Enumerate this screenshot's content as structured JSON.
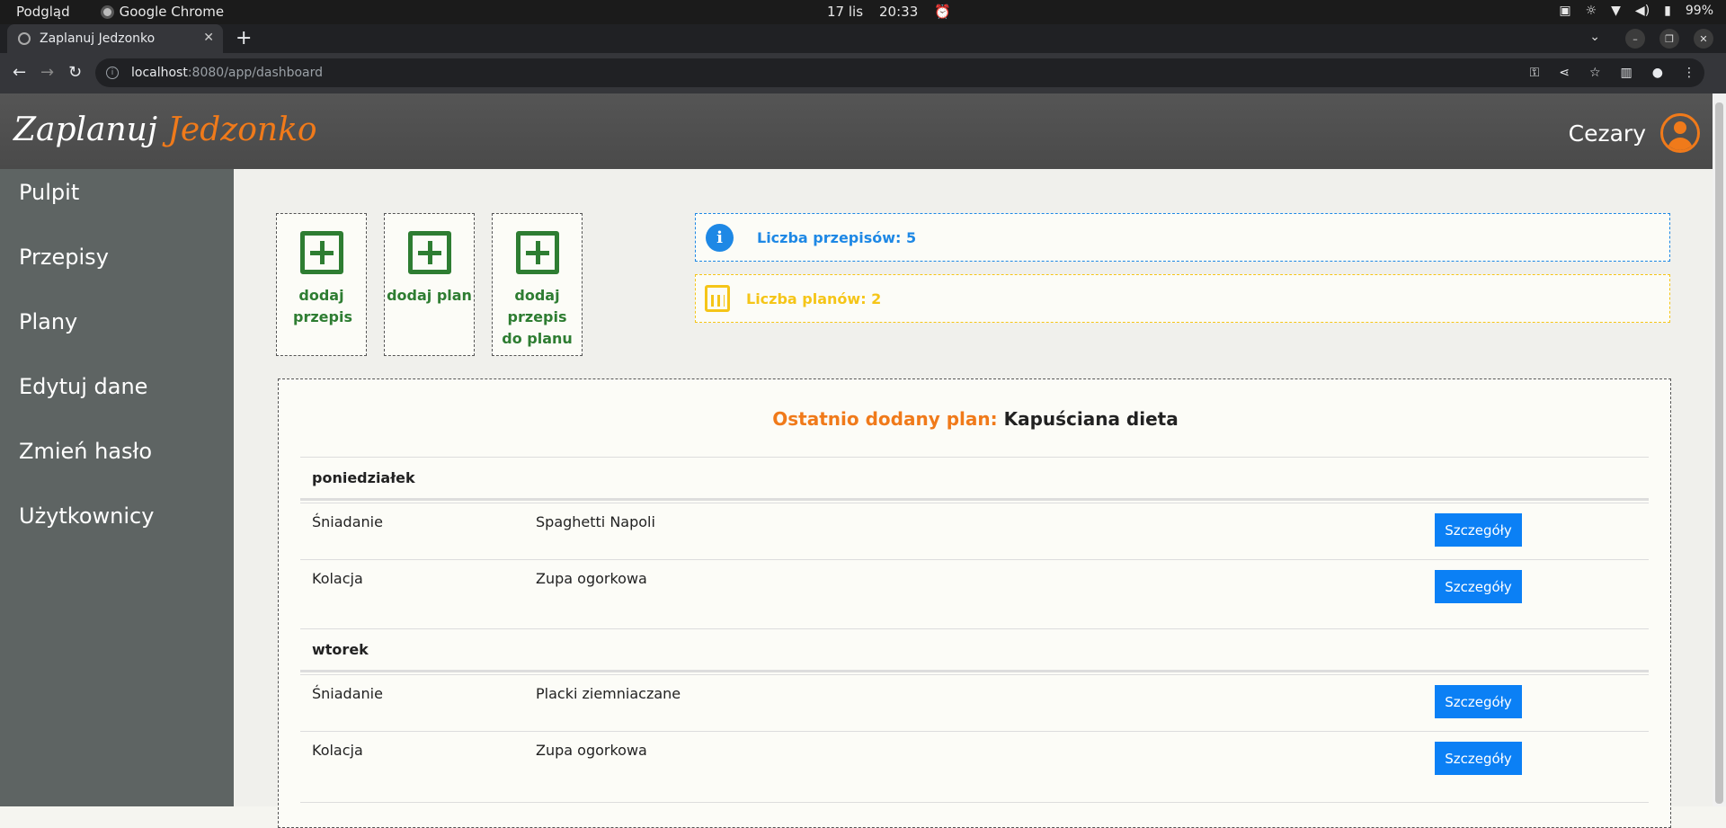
{
  "os": {
    "activities": "Podgląd",
    "app_name": "Google Chrome",
    "date": "17 lis",
    "time": "20:33",
    "battery": "99%"
  },
  "browser": {
    "tab_title": "Zaplanuj Jedzonko",
    "url_host": "localhost",
    "url_rest": ":8080/app/dashboard"
  },
  "header": {
    "logo_main": "Zaplanuj",
    "logo_accent": "Jedzonko",
    "username": "Cezary",
    "accent_color": "#f07a1a"
  },
  "sidebar": {
    "items": [
      {
        "label": "Pulpit"
      },
      {
        "label": "Przepisy"
      },
      {
        "label": "Plany"
      },
      {
        "label": "Edytuj dane"
      },
      {
        "label": "Zmień hasło"
      },
      {
        "label": "Użytkownicy"
      }
    ]
  },
  "tiles": [
    {
      "label": "dodaj przepis"
    },
    {
      "label": "dodaj plan"
    },
    {
      "label": "dodaj przepis do planu"
    }
  ],
  "stats": {
    "recipes": "Liczba przepisów: 5",
    "plans": "Liczba planów: 2"
  },
  "plan": {
    "label": "Ostatnio dodany plan:",
    "name": "Kapuściana dieta",
    "details_label": "Szczegóły",
    "days": [
      {
        "name": "poniedziałek",
        "meals": [
          {
            "meal": "Śniadanie",
            "recipe": "Spaghetti Napoli"
          },
          {
            "meal": "Kolacja",
            "recipe": "Zupa ogorkowa"
          }
        ]
      },
      {
        "name": "wtorek",
        "meals": [
          {
            "meal": "Śniadanie",
            "recipe": "Placki ziemniaczane"
          },
          {
            "meal": "Kolacja",
            "recipe": "Zupa ogorkowa"
          }
        ]
      }
    ]
  }
}
